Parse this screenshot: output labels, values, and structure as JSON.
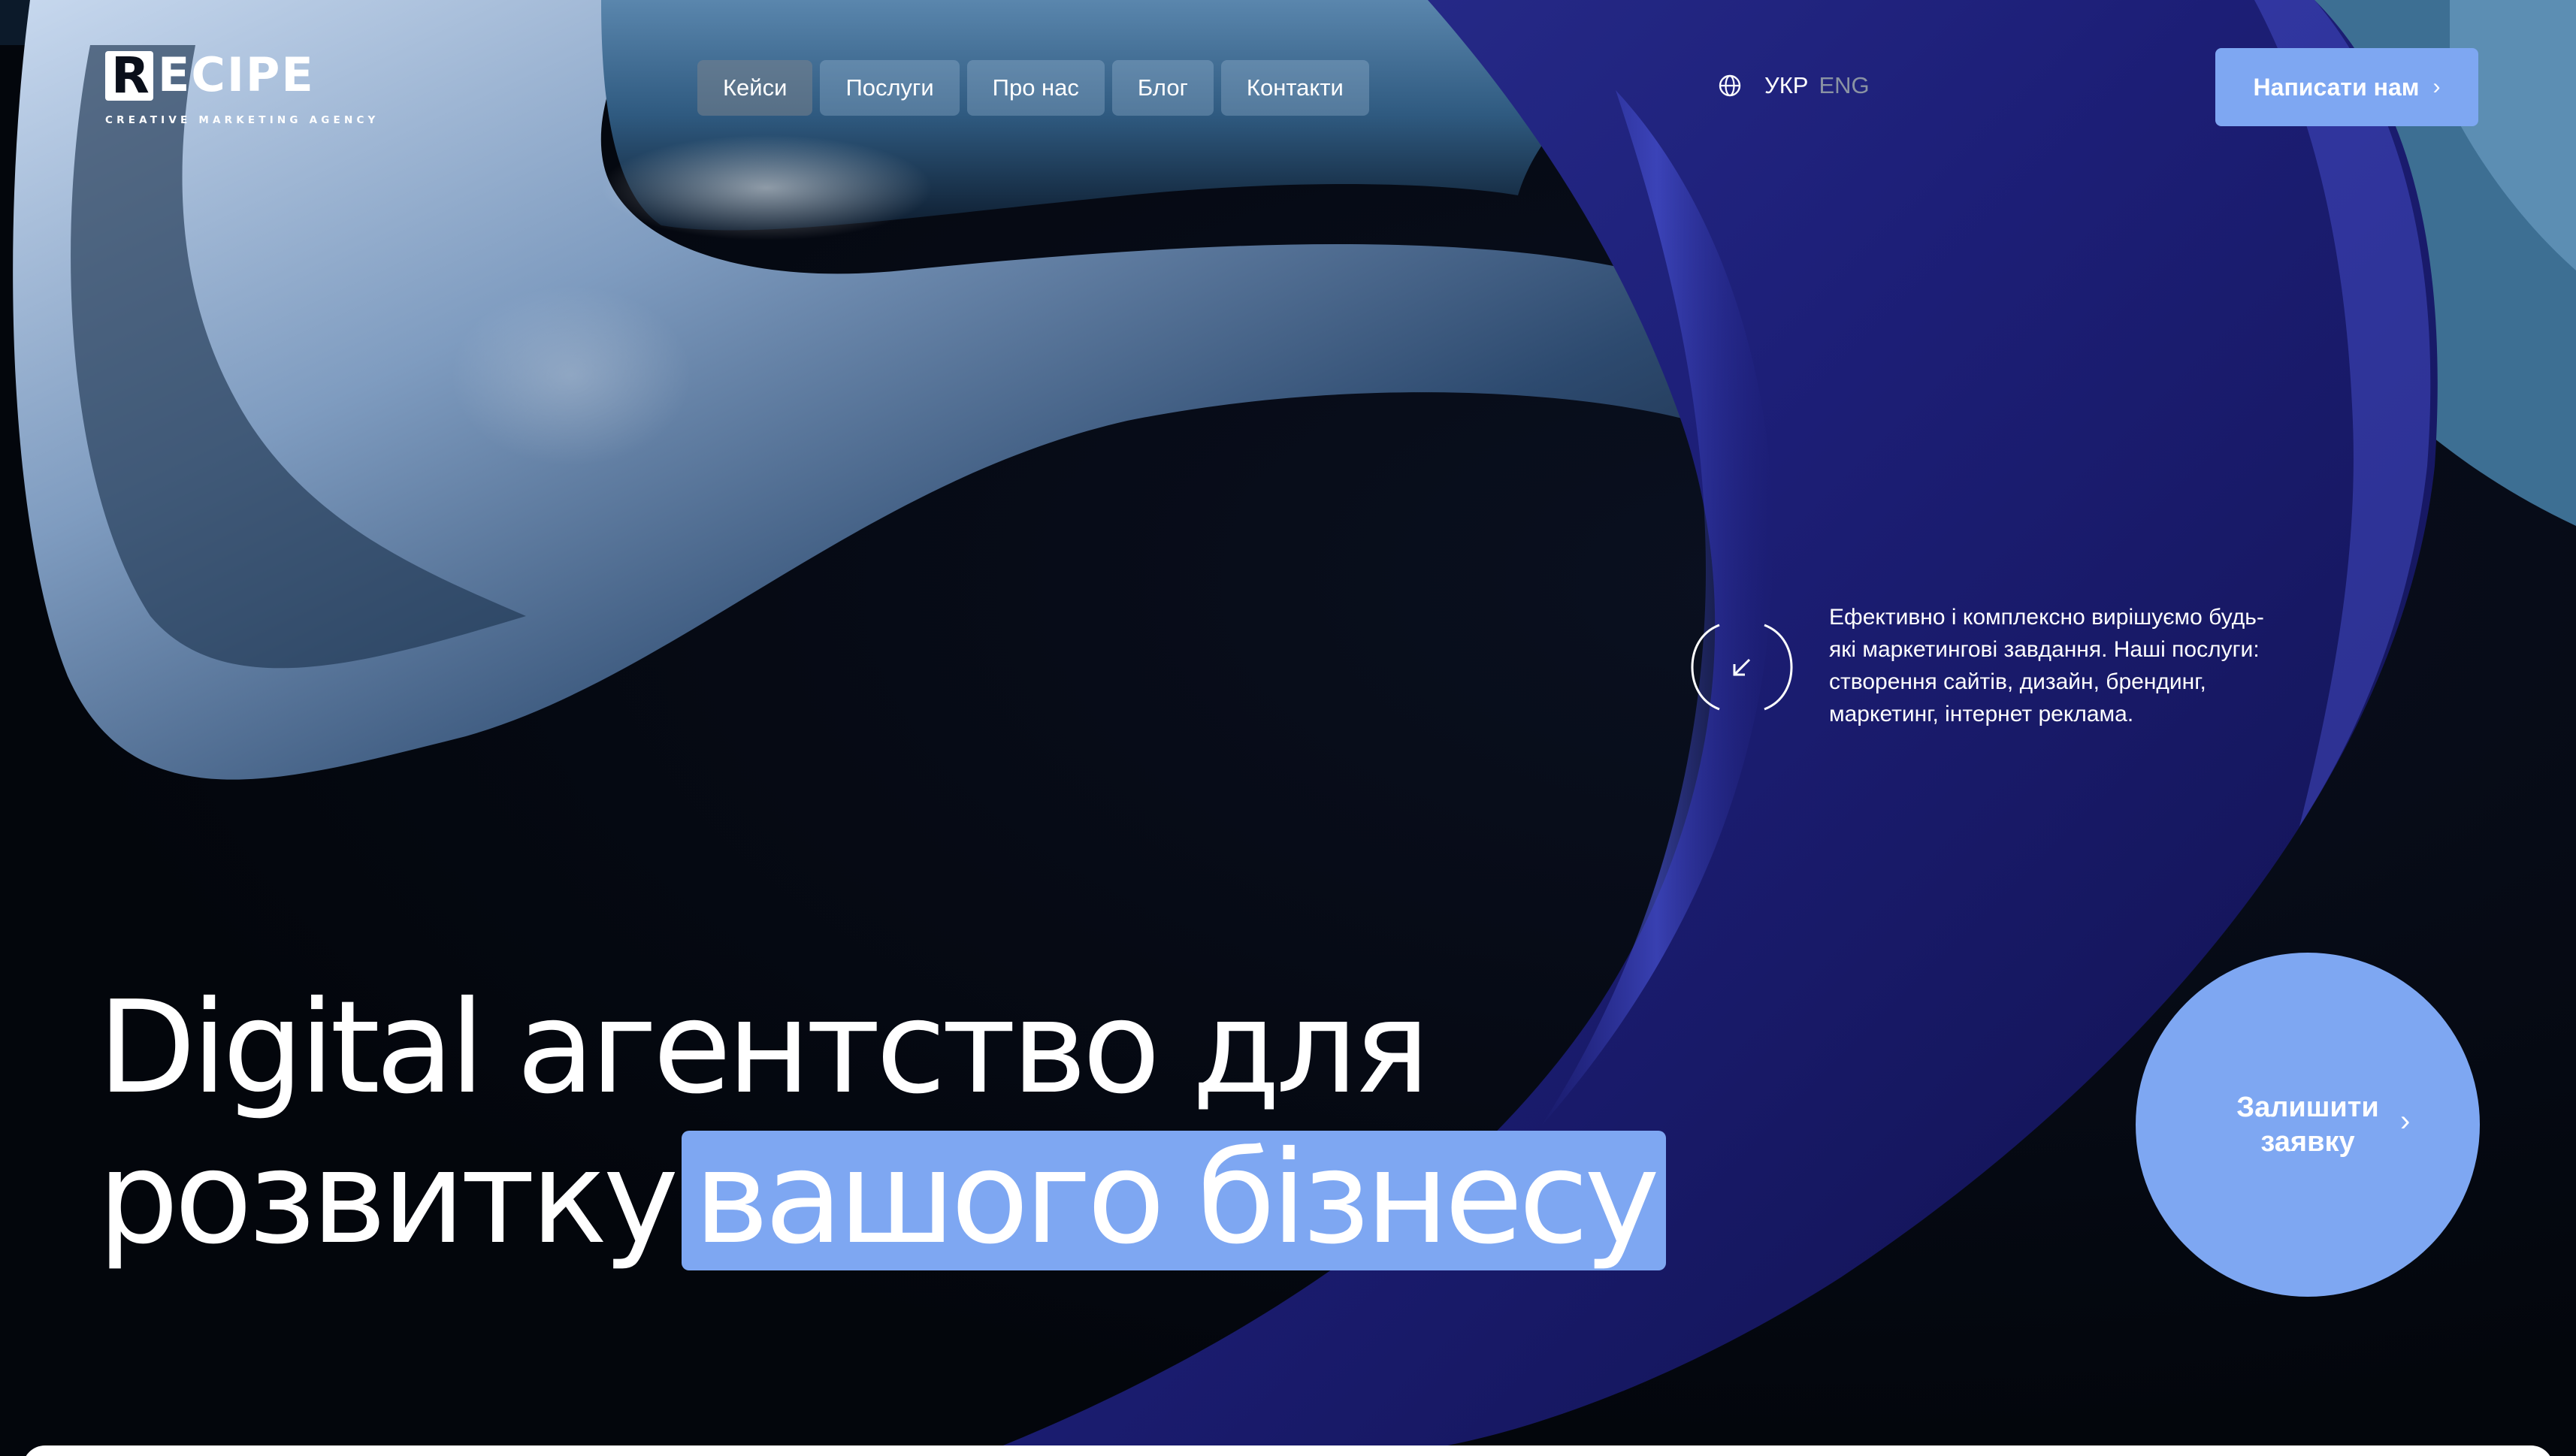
{
  "header": {
    "logo_word": "ECIPE",
    "logo_letter": "R",
    "logo_tagline": "CREATIVE MARKETING AGENCY",
    "nav": [
      {
        "label": "Кейси",
        "active": true
      },
      {
        "label": "Послуги",
        "active": false
      },
      {
        "label": "Про нас",
        "active": false
      },
      {
        "label": "Блог",
        "active": false
      },
      {
        "label": "Контакти",
        "active": false
      }
    ],
    "lang": {
      "icon": "globe-icon",
      "current": "УКР",
      "other": "ENG"
    },
    "cta_label": "Написати нам",
    "cta_icon": "chevron-right-icon"
  },
  "hero": {
    "description": "Ефективно і комплексно вирішуємо будь-які маркетингові завдання. Наші послуги: створення сайтів, дизайн, брендинг, маркетинг, інтернет реклама.",
    "description_icon": "arrow-down-left-icon",
    "headline_line1": "Digital агентство для",
    "headline_line2_plain": "розвитку",
    "headline_line2_accent": "вашого бізнесу",
    "round_cta_label": "Залишити\nзаявку",
    "round_cta_icon": "chevron-right-icon"
  },
  "colors": {
    "accent": "#7ea7f2",
    "background": "#04080f",
    "nav_active": "#5f6870"
  }
}
